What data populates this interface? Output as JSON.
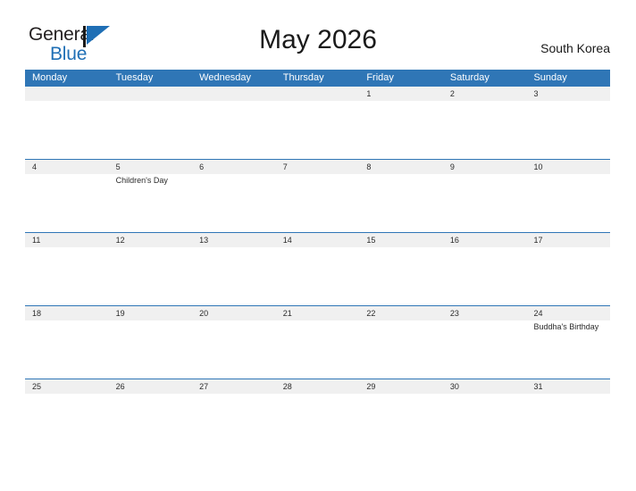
{
  "brand": {
    "name_part1": "General",
    "name_part2": "Blue",
    "flag_icon": "blue-triangle-flag-icon",
    "accent_color": "#1f6fb5"
  },
  "header": {
    "title": "May 2026",
    "region": "South Korea"
  },
  "theme": {
    "header_blue": "#2f76b6",
    "date_band_gray": "#f0f0f0",
    "text_color": "#2b2b2b",
    "page_background": "#ffffff"
  },
  "calendar": {
    "month": "May",
    "year": "2026",
    "weekday_headers": [
      "Monday",
      "Tuesday",
      "Wednesday",
      "Thursday",
      "Friday",
      "Saturday",
      "Sunday"
    ],
    "weeks": [
      {
        "days": [
          {
            "number": "",
            "events": []
          },
          {
            "number": "",
            "events": []
          },
          {
            "number": "",
            "events": []
          },
          {
            "number": "",
            "events": []
          },
          {
            "number": "1",
            "events": []
          },
          {
            "number": "2",
            "events": []
          },
          {
            "number": "3",
            "events": []
          }
        ]
      },
      {
        "days": [
          {
            "number": "4",
            "events": []
          },
          {
            "number": "5",
            "events": [
              "Children's Day"
            ]
          },
          {
            "number": "6",
            "events": []
          },
          {
            "number": "7",
            "events": []
          },
          {
            "number": "8",
            "events": []
          },
          {
            "number": "9",
            "events": []
          },
          {
            "number": "10",
            "events": []
          }
        ]
      },
      {
        "days": [
          {
            "number": "11",
            "events": []
          },
          {
            "number": "12",
            "events": []
          },
          {
            "number": "13",
            "events": []
          },
          {
            "number": "14",
            "events": []
          },
          {
            "number": "15",
            "events": []
          },
          {
            "number": "16",
            "events": []
          },
          {
            "number": "17",
            "events": []
          }
        ]
      },
      {
        "days": [
          {
            "number": "18",
            "events": []
          },
          {
            "number": "19",
            "events": []
          },
          {
            "number": "20",
            "events": []
          },
          {
            "number": "21",
            "events": []
          },
          {
            "number": "22",
            "events": []
          },
          {
            "number": "23",
            "events": []
          },
          {
            "number": "24",
            "events": [
              "Buddha's Birthday"
            ]
          }
        ]
      },
      {
        "days": [
          {
            "number": "25",
            "events": []
          },
          {
            "number": "26",
            "events": []
          },
          {
            "number": "27",
            "events": []
          },
          {
            "number": "28",
            "events": []
          },
          {
            "number": "29",
            "events": []
          },
          {
            "number": "30",
            "events": []
          },
          {
            "number": "31",
            "events": []
          }
        ]
      }
    ]
  }
}
